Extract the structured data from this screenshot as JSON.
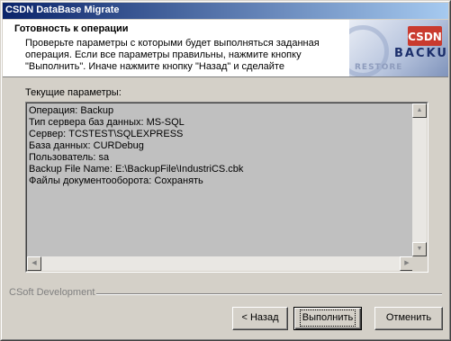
{
  "window": {
    "title": "CSDN DataBase Migrate"
  },
  "header": {
    "title": "Готовность к операции",
    "description": "Проверьте параметры с которыми будет выполняться заданная операция. Если все параметры правильны, нажмите кнопку \"Выполнить\". Иначе нажмите кнопку \"Назад\" и сделайте",
    "logo": {
      "mark": "CSDN",
      "backup": "BACKUP",
      "restore": "RESTORE"
    }
  },
  "params": {
    "label": "Текущие параметры:",
    "lines": [
      "Операция: Backup",
      "Тип сервера баз данных: MS-SQL",
      "Сервер: TCSTEST\\SQLEXPRESS",
      "База данных: CURDebug",
      "Пользователь: sa",
      "Backup File Name: E:\\BackupFile\\IndustriCS.cbk",
      "Файлы документооборота: Сохранять"
    ]
  },
  "scroll": {
    "up": "▲",
    "down": "▼",
    "left": "◀",
    "right": "▶"
  },
  "footer": {
    "brand": "CSoft Development"
  },
  "buttons": {
    "back": "< Назад",
    "execute": "Выполнить",
    "cancel": "Отменить"
  }
}
